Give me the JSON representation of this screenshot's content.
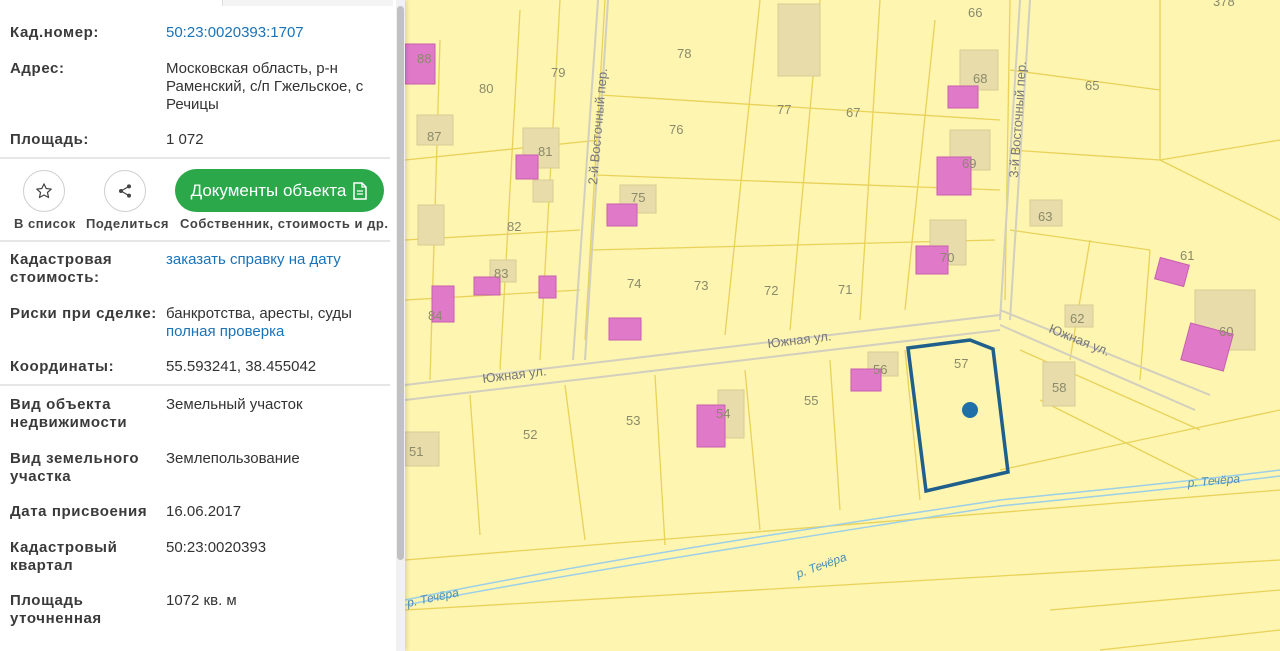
{
  "panel": {
    "fields": [
      {
        "label": "Кад.номер:",
        "value": "50:23:0020393:1707",
        "link": true
      },
      {
        "label": "Адрес:",
        "value": "Московская область, р-н Раменский, с/п Гжельское, с Речицы"
      },
      {
        "label": "Площадь:",
        "value": "1 072"
      }
    ],
    "actions": {
      "favorite_label": "В список",
      "share_label": "Поделиться",
      "docs_button_label": "Документы объекта",
      "docs_caption": "Собственник, стоимость и др."
    },
    "details": [
      {
        "label": "Кадастровая стоимость:",
        "value": "заказать справку на дату",
        "link": true
      },
      {
        "label": "Риски при сделке:",
        "value": "банкротства, аресты, суды",
        "value2": "полная проверка"
      },
      {
        "label": "Координаты:",
        "value": "55.593241, 38.455042"
      },
      {
        "label": "Вид объекта недвижимости",
        "value": "Земельный участок"
      },
      {
        "label": "Вид земельного участка",
        "value": "Землепользование"
      },
      {
        "label": "Дата присвоения",
        "value": "16.06.2017"
      },
      {
        "label": "Кадастровый квартал",
        "value": "50:23:0020393"
      },
      {
        "label": "Площадь уточненная",
        "value": "1072 кв. м"
      }
    ]
  },
  "map": {
    "colors": {
      "land": "#fdf5b0",
      "parcel_line": "#e8d25a",
      "building": "#e079c8",
      "selection": "#1f5f8b",
      "river": "#9ccfe8",
      "street": "#c9c9c0"
    },
    "parcel_numbers": [
      "66",
      "378",
      "88",
      "80",
      "79",
      "78",
      "65",
      "68",
      "87",
      "81",
      "76",
      "77",
      "67",
      "69",
      "75",
      "63",
      "82",
      "70",
      "61",
      "83",
      "74",
      "73",
      "72",
      "71",
      "84",
      "62",
      "60",
      "57",
      "56",
      "58",
      "55",
      "54",
      "53",
      "52",
      "51"
    ],
    "streets": [
      "2-й Восточный пер.",
      "3-й Восточный пер.",
      "Южная ул.",
      "Южная ул.",
      "Южная ул."
    ],
    "rivers": [
      "р. Течёра",
      "р. Течёра",
      "р. Течёра"
    ]
  }
}
